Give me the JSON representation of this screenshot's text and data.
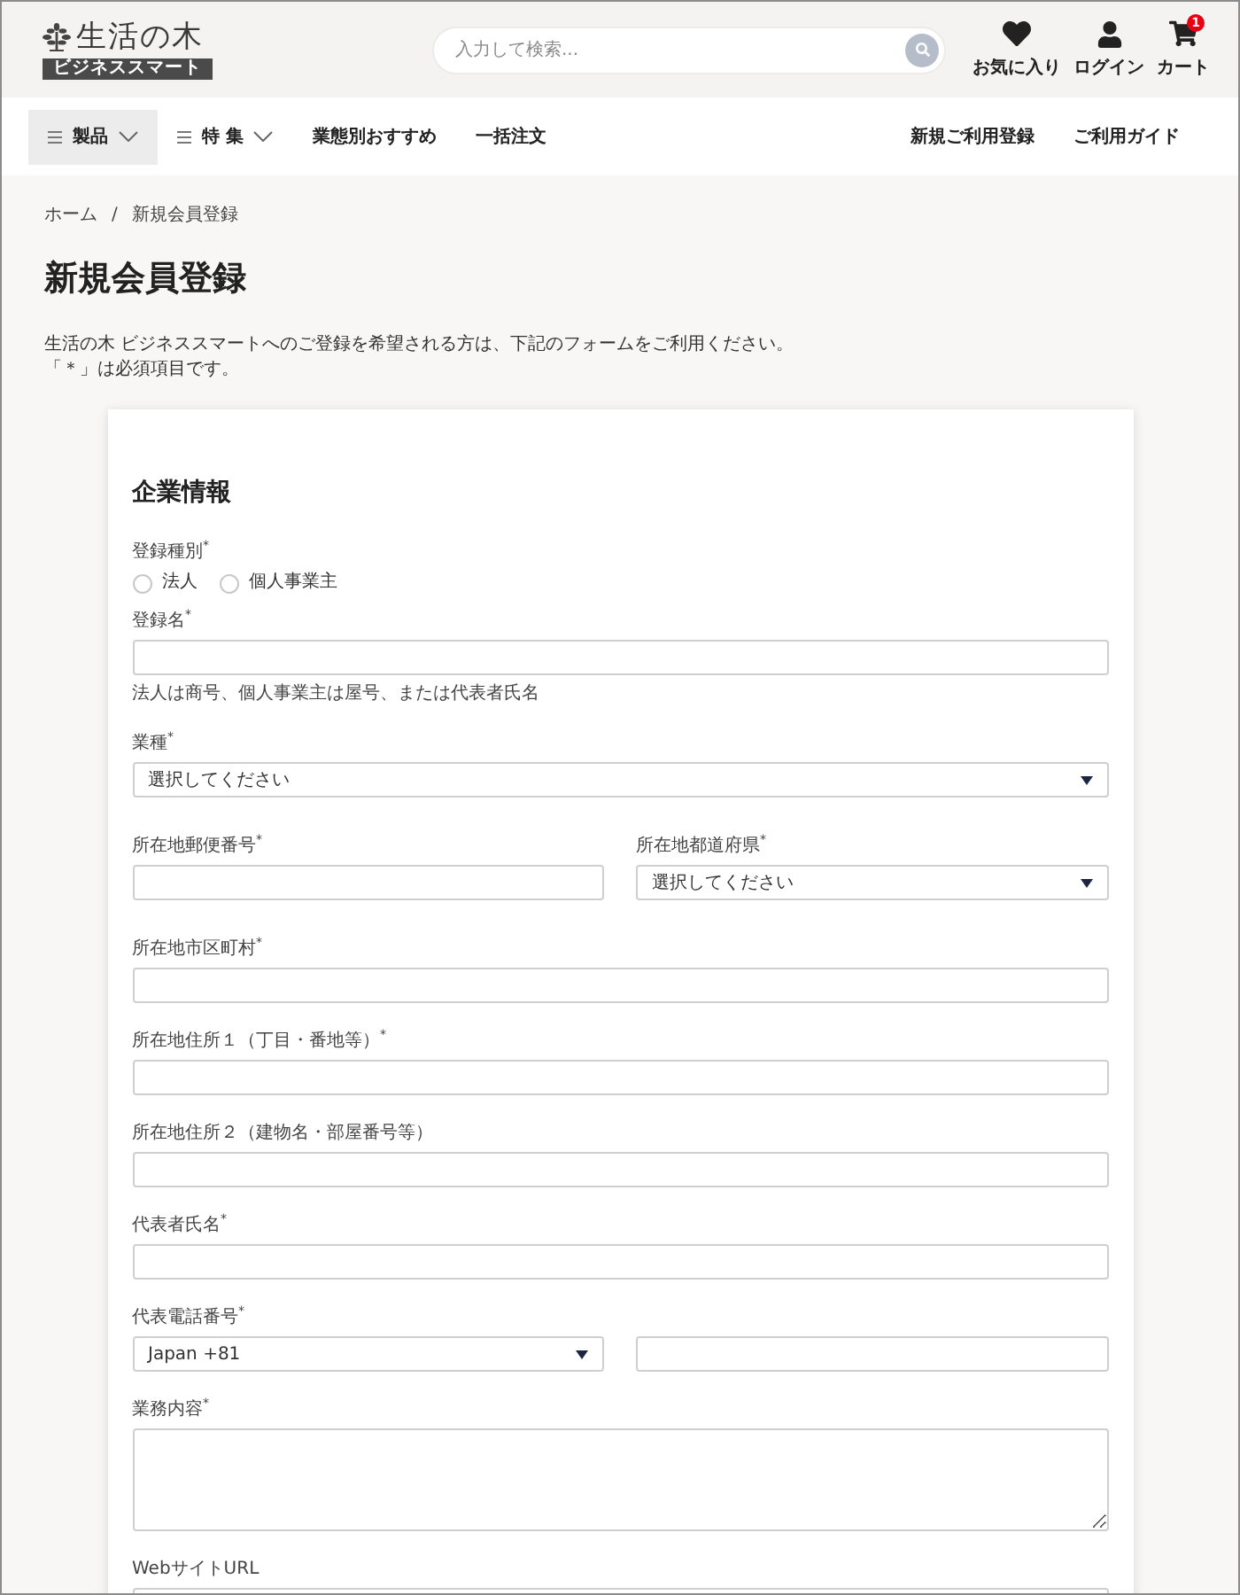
{
  "header": {
    "logo": {
      "name": "生活の木",
      "tagline": "ビジネススマート"
    },
    "search": {
      "placeholder": "入力して検索..."
    },
    "actions": [
      {
        "kind": "favorites",
        "label": "お気に入り"
      },
      {
        "kind": "login",
        "label": "ログイン"
      },
      {
        "kind": "cart",
        "label": "カート",
        "badge": "1"
      }
    ]
  },
  "nav": {
    "left": [
      {
        "kind": "dropdown",
        "label": "製品",
        "selected": true
      },
      {
        "kind": "dropdown",
        "label": "特 集",
        "selected": false
      },
      {
        "kind": "link",
        "label": "業態別おすすめ",
        "selected": false
      },
      {
        "kind": "link",
        "label": "一括注文",
        "selected": false
      }
    ],
    "right": [
      "新規ご利用登録",
      "ご利用ガイド"
    ]
  },
  "breadcrumb": {
    "items": [
      "ホーム",
      "新規会員登録"
    ],
    "separator": "/"
  },
  "title": "新規会員登録",
  "intro": [
    "生活の木 ビジネススマートへのご登録を希望される方は、下記のフォームをご利用ください。",
    "「＊」は必須項目です。"
  ],
  "form": {
    "title": "企業情報",
    "fields": [
      {
        "kind": "radio",
        "label": "登録種別$^{*}$",
        "options": [
          {
            "label": "法人",
            "selected": false
          },
          {
            "label": "個人事業主",
            "selected": false
          }
        ]
      },
      {
        "kind": "text",
        "label": "登録名$^{*}$",
        "hint": "法人は商号、個人事業主は屋号、または代表者氏名"
      },
      {
        "kind": "select",
        "label": "業種$^{*}$",
        "value": "選択してください"
      },
      {
        "kind": "pair",
        "items": [
          {
            "kind": "text",
            "label": "所在地郵便番号$^{*}$"
          },
          {
            "kind": "select",
            "label": "所在地都道府県$^{*}$",
            "value": "選択してください"
          }
        ]
      },
      {
        "kind": "text",
        "label": "所在地市区町村$^{*}$"
      },
      {
        "kind": "text",
        "label": "所在地住所１（丁目・番地等）$^{*}$"
      },
      {
        "kind": "text",
        "label": "所在地住所２（建物名・部屋番号等）"
      },
      {
        "kind": "text",
        "label": "代表者氏名$^{*}$"
      },
      {
        "kind": "pair",
        "label": "代表電話番号$^{*}$",
        "items": [
          {
            "kind": "select",
            "value": "Japan +81"
          },
          {
            "kind": "text"
          }
        ]
      },
      {
        "kind": "textarea",
        "label": "業務内容$^{*}$"
      },
      {
        "kind": "text",
        "label": "WebサイトURL"
      }
    ]
  }
}
